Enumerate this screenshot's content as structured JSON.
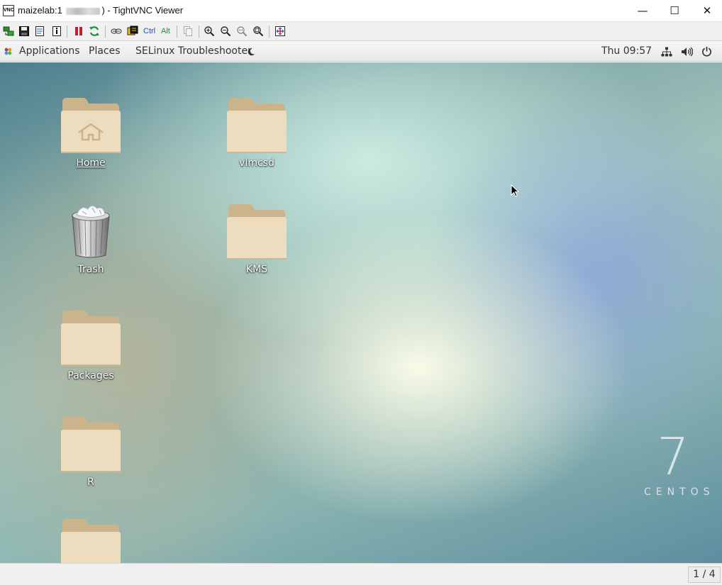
{
  "window": {
    "icon_text": "VNC",
    "title_prefix": "maizelab:1 ",
    "title_suffix": ") - TightVNC Viewer",
    "minimize_glyph": "—",
    "maximize_glyph": "☐",
    "close_glyph": "✕"
  },
  "toolbar": {
    "ctrl_label": "Ctrl",
    "alt_label": "Alt",
    "icons": [
      "new-connection-icon",
      "save-icon",
      "options-icon",
      "info-icon",
      "pause-icon",
      "refresh-icon",
      "transfer-icon",
      "ctrl-alt-del-icon",
      "clipboard-icon",
      "zoom-in-icon",
      "zoom-out-icon",
      "zoom-100-icon",
      "zoom-fit-icon",
      "fullscreen-icon"
    ]
  },
  "panel": {
    "applications": "Applications",
    "places": "Places",
    "selinux": "SELinux Troubleshooter",
    "clock": "Thu 09:57"
  },
  "desktop": {
    "icons": {
      "home": "Home",
      "vlmcsd": "vlmcsd",
      "trash": "Trash",
      "kms": "KMS",
      "packages": "Packages",
      "r": "R"
    },
    "centos_number": "7",
    "centos_word": "CENTOS"
  },
  "statusbar": {
    "page": "1 / 4"
  },
  "colors": {
    "folder_body": "#eddcbd",
    "folder_tab": "#cbb48c"
  }
}
